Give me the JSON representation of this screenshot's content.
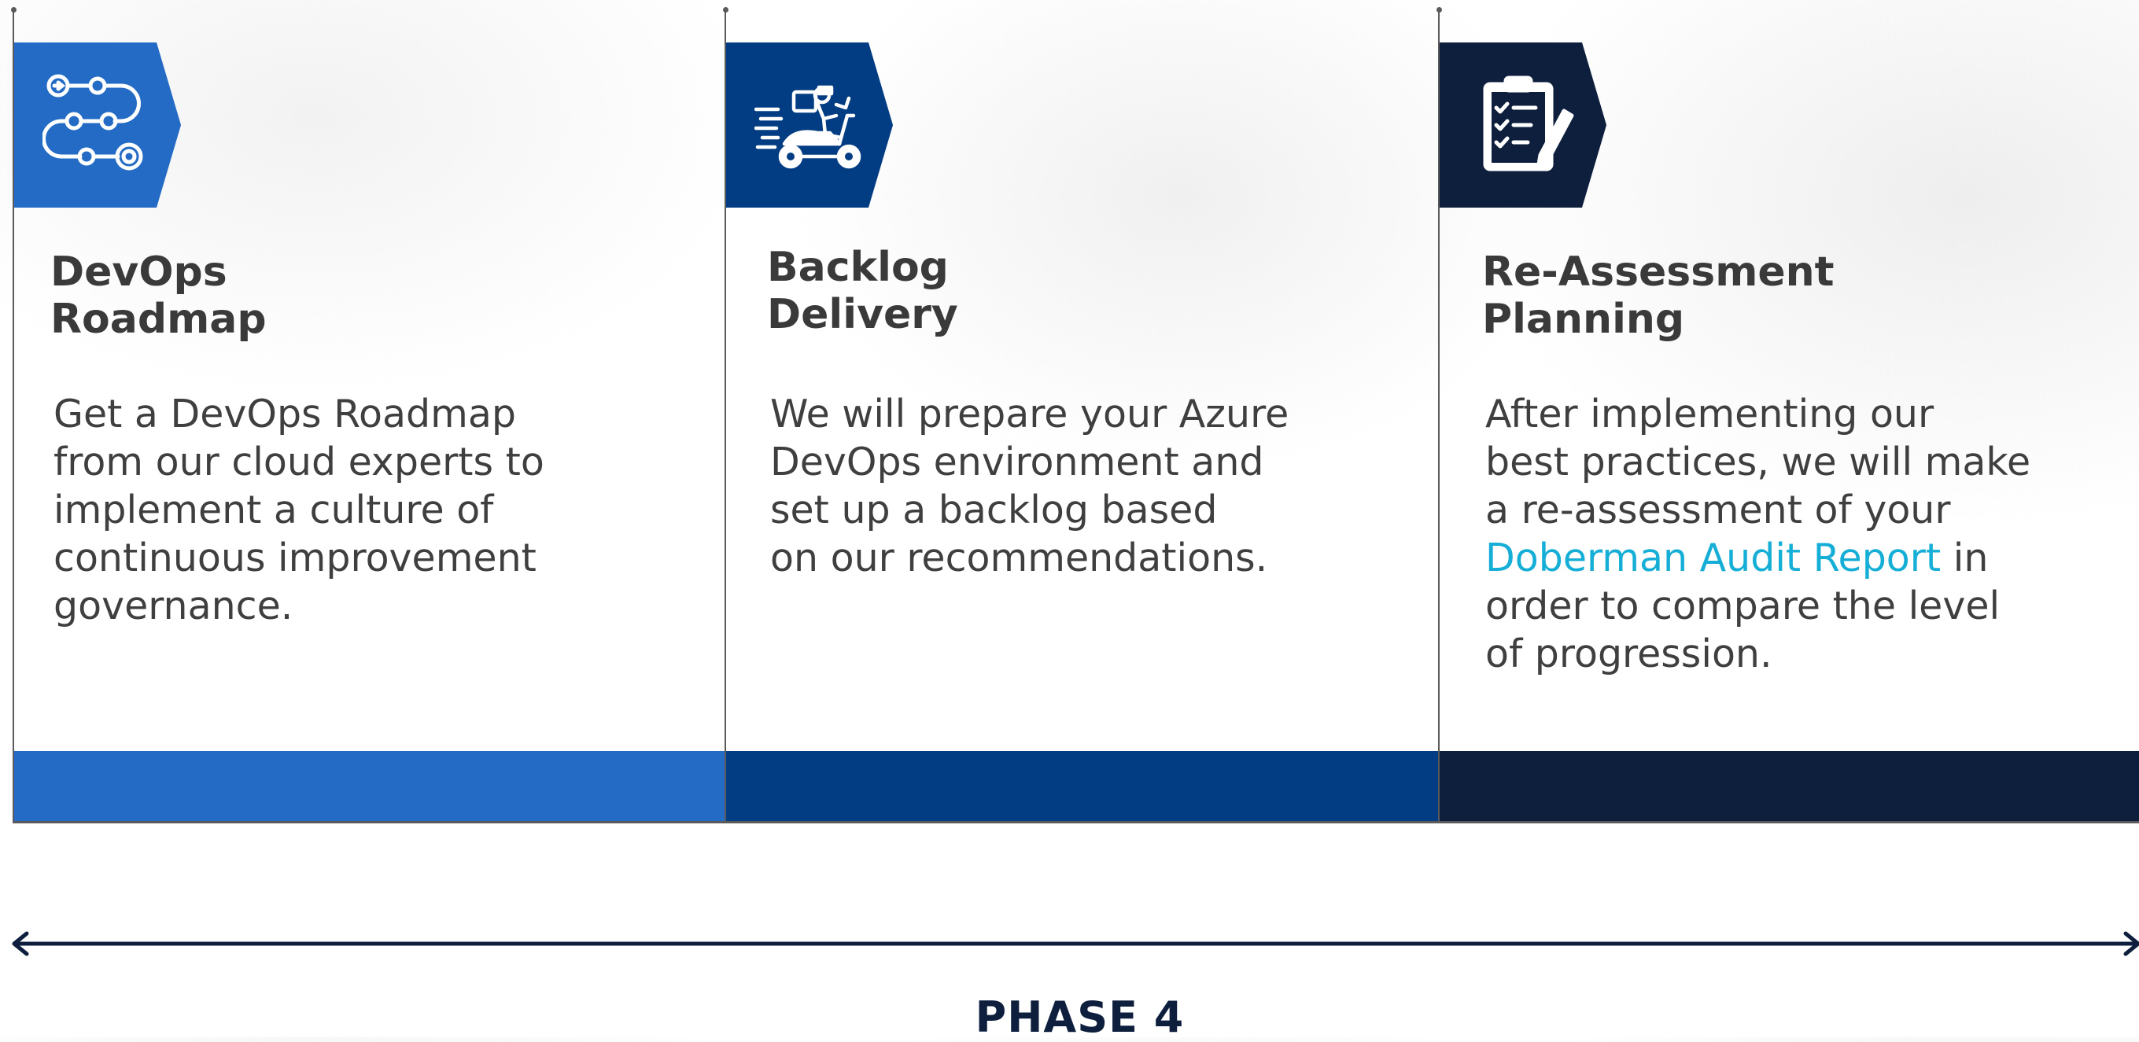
{
  "colors": {
    "step1": "#236bc5",
    "step2": "#023d84",
    "step3": "#0e1f3d",
    "text": "#3f3f3f",
    "highlight": "#15aed6",
    "timeline": "#0e1f3e"
  },
  "steps": [
    {
      "icon": "path-route-icon",
      "title": "DevOps\nRoadmap",
      "body": "Get a DevOps Roadmap\nfrom our cloud experts to\nimplement a culture of\ncontinuous improvement\ngovernance."
    },
    {
      "icon": "delivery-scooter-icon",
      "title": "Backlog\nDelivery",
      "body": "We will prepare your Azure\nDevOps environment and\nset up a backlog based\non our recommendations."
    },
    {
      "icon": "checklist-clipboard-icon",
      "title": "Re-Assessment\nPlanning",
      "body_before": "After implementing our\nbest practices, we will make\na re-assessment of your\n",
      "body_highlight": "Doberman Audit Report",
      "body_after": " in\norder to compare the level\nof progression."
    }
  ],
  "phase_label": "PHASE 4"
}
